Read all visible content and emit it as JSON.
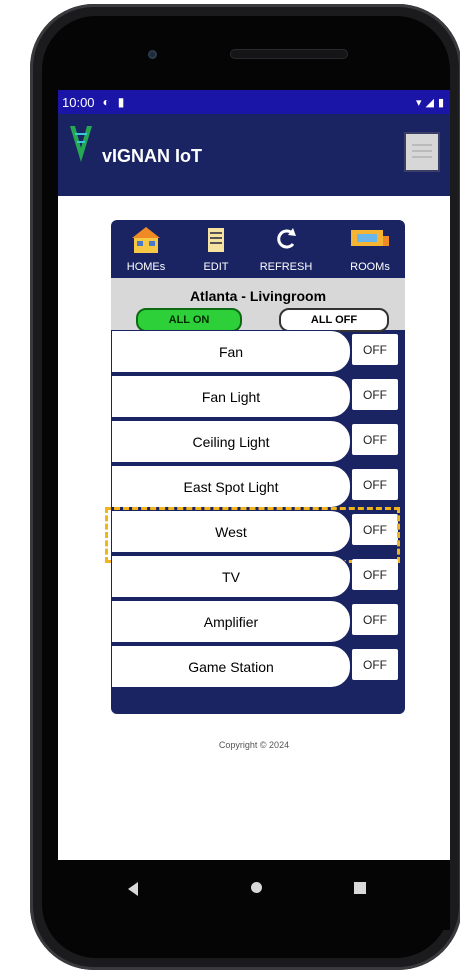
{
  "status": {
    "time": "10:00"
  },
  "app": {
    "title": "vIGNAN IoT"
  },
  "toolbar": {
    "homes": "HOMEs",
    "edit": "EDIT",
    "refresh": "REFRESH",
    "rooms": "ROOMs"
  },
  "location": {
    "title": "Atlanta - Livingroom"
  },
  "controls": {
    "all_on": "ALL ON",
    "all_off": "ALL OFF"
  },
  "devices": [
    {
      "name": "Fan",
      "state": "OFF"
    },
    {
      "name": "Fan Light",
      "state": "OFF"
    },
    {
      "name": "Ceiling Light",
      "state": "OFF"
    },
    {
      "name": "East Spot Light",
      "state": "OFF"
    },
    {
      "name": "West",
      "state": "OFF"
    },
    {
      "name": "TV",
      "state": "OFF"
    },
    {
      "name": "Amplifier",
      "state": "OFF"
    },
    {
      "name": "Game Station",
      "state": "OFF"
    }
  ],
  "footer": {
    "copyright": "Copyright © 2024"
  },
  "colors": {
    "statusbar": "#1a14a7",
    "appbar": "#1a2463",
    "accent_on": "#2ed03a",
    "highlight": "#f2b41c"
  }
}
